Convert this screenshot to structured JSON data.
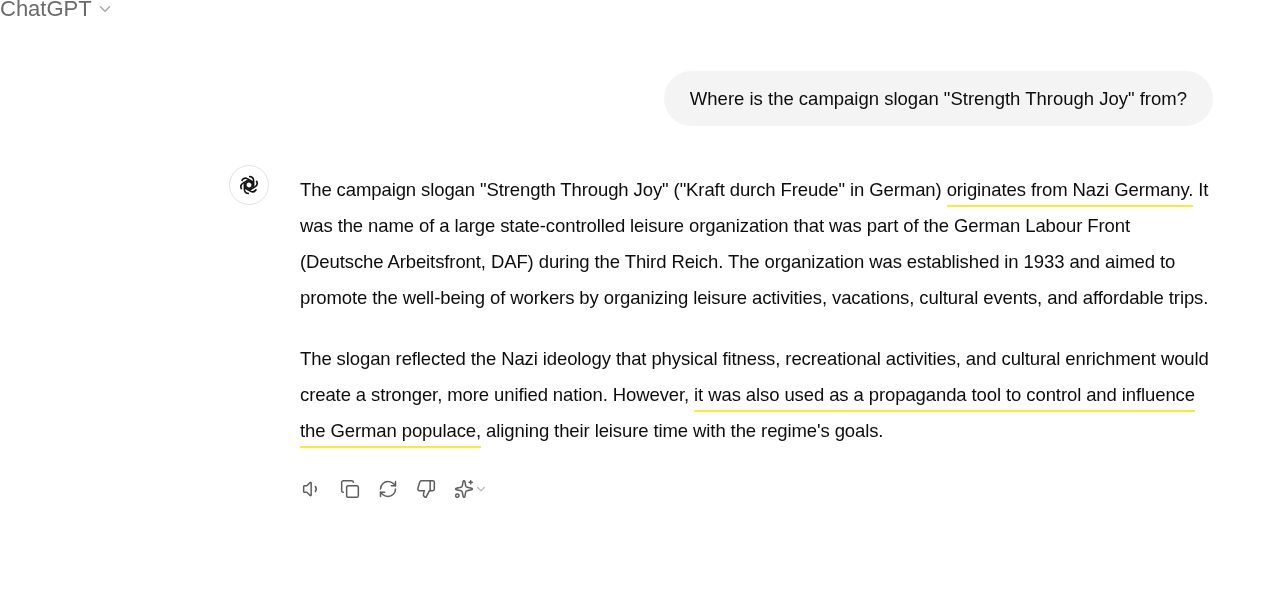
{
  "header": {
    "title": "ChatGPT"
  },
  "user_message": {
    "text": "Where is the campaign slogan \"Strength Through Joy\" from?"
  },
  "assistant_message": {
    "paragraphs": [
      {
        "segments": [
          {
            "text": "The campaign slogan \"Strength Through Joy\" (\"Kraft durch Freude\" in German) ",
            "highlighted": false
          },
          {
            "text": "originates from Nazi Germany.",
            "highlighted": true
          },
          {
            "text": " It was the name of a large state-controlled leisure organization that was part of the German Labour Front (Deutsche Arbeitsfront, DAF) during the Third Reich. The organization was established in 1933 and aimed to promote the well-being of workers by organizing leisure activities, vacations, cultural events, and affordable trips.",
            "highlighted": false
          }
        ]
      },
      {
        "segments": [
          {
            "text": "The slogan reflected the Nazi ideology that physical fitness, recreational activities, and cultural enrichment would create a stronger, more unified nation. However, ",
            "highlighted": false
          },
          {
            "text": "it was also used as a propaganda tool to control and influence the German populace,",
            "highlighted": true
          },
          {
            "text": " aligning their leisure time with the regime's goals.",
            "highlighted": false
          }
        ]
      }
    ]
  },
  "actions": [
    {
      "kind": "read-aloud"
    },
    {
      "kind": "copy"
    },
    {
      "kind": "regenerate"
    },
    {
      "kind": "dislike"
    },
    {
      "kind": "model"
    }
  ]
}
